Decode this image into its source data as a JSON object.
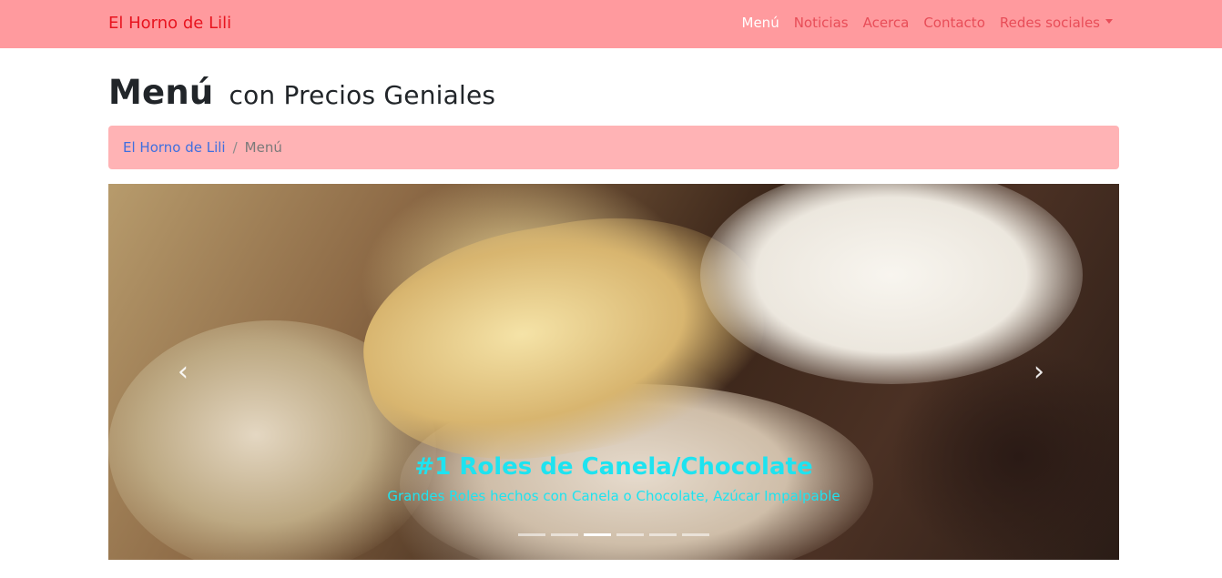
{
  "navbar": {
    "brand": "El Horno de Lili",
    "items": [
      {
        "label": "Menú",
        "active": true
      },
      {
        "label": "Noticias"
      },
      {
        "label": "Acerca"
      },
      {
        "label": "Contacto"
      },
      {
        "label": "Redes sociales",
        "dropdown": true
      }
    ]
  },
  "page": {
    "title": "Menú",
    "subtitle": "con Precios Geniales"
  },
  "breadcrumb": {
    "home": "El Horno de Lili",
    "separator": "/",
    "current": "Menú"
  },
  "carousel": {
    "caption_title": "#1 Roles de Canela/Chocolate",
    "caption_text": "Grandes Roles hechos con Canela o Chocolate, Azúcar Impalpable",
    "indicator_count": 6,
    "active_index": 2,
    "prev_icon": "chevron-left-icon",
    "next_icon": "chevron-right-icon"
  },
  "colors": {
    "navbar": "#ff9a9e",
    "brand": "#e8141f",
    "nav_link": "#e84d58",
    "breadcrumb_bg": "#ffb3b5",
    "caption": "#1ee3f0"
  }
}
